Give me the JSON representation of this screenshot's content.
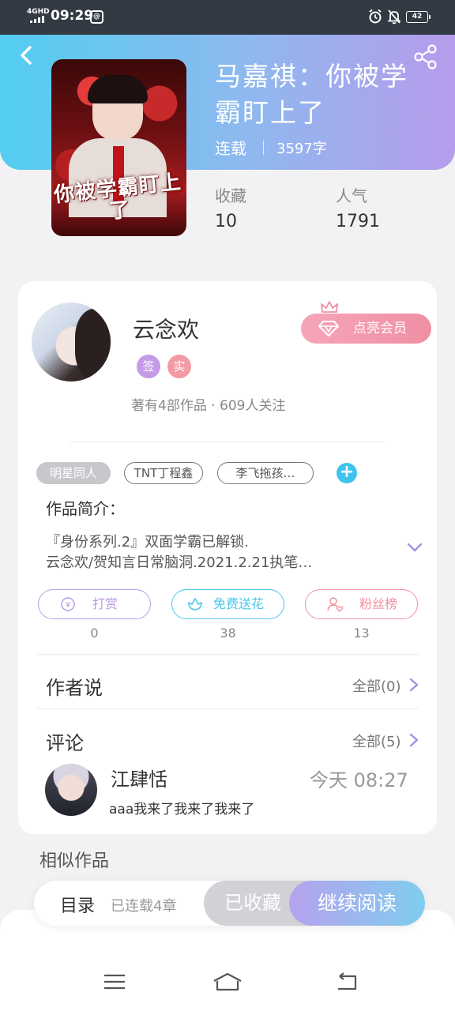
{
  "status_bar": {
    "network": "4GHD",
    "time": "09:29",
    "app_icon": "@",
    "battery": "42"
  },
  "book": {
    "cover_text": "你被学霸盯上了",
    "title": "马嘉祺：你被学霸盯上了",
    "status": "连载",
    "word_count": "3597字",
    "collect_label": "收藏",
    "collect_value": "10",
    "popularity_label": "人气",
    "popularity_value": "1791"
  },
  "author": {
    "name": "云念欢",
    "badges": [
      "签",
      "实"
    ],
    "badge_colors": [
      "#c59ae6",
      "#f29ba5"
    ],
    "meta": "著有4部作品 · 609人关注",
    "vip_button": "点亮会员"
  },
  "tags": [
    {
      "label": "明星同人",
      "active": true
    },
    {
      "label": "TNT丁程鑫",
      "active": false
    },
    {
      "label": "李飞拖孩…",
      "active": false
    }
  ],
  "intro": {
    "label": "作品简介：",
    "line1": "『身份系列.2』双面学霸已解锁.",
    "line2": "云念欢/贺知言日常脑洞.2021.2.21执笔…"
  },
  "actions": [
    {
      "label": "打赏",
      "count": "0",
      "color": "#b89be8",
      "icon": "coin-icon"
    },
    {
      "label": "免费送花",
      "count": "38",
      "color": "#4cc8ea",
      "icon": "flower-icon"
    },
    {
      "label": "粉丝榜",
      "count": "13",
      "color": "#f2919f",
      "icon": "fan-icon"
    }
  ],
  "author_says": {
    "title": "作者说",
    "more": "全部(0)"
  },
  "comments": {
    "title": "评论",
    "more": "全部(5)",
    "items": [
      {
        "name": "江肆恬",
        "time": "今天 08:27",
        "text": "aaa我来了我来了我来了"
      }
    ]
  },
  "similar": {
    "title": "相似作品"
  },
  "bottom_bar": {
    "toc_label": "目录",
    "toc_count": "已连载4章",
    "collected": "已收藏",
    "continue": "继续阅读"
  },
  "colors": {
    "header_gradient_start": "#52cef0",
    "header_gradient_end": "#b69cec",
    "vip_pink": "#f08fa4",
    "accent_cyan": "#3fc3ec",
    "accent_purple": "#b89be8"
  }
}
